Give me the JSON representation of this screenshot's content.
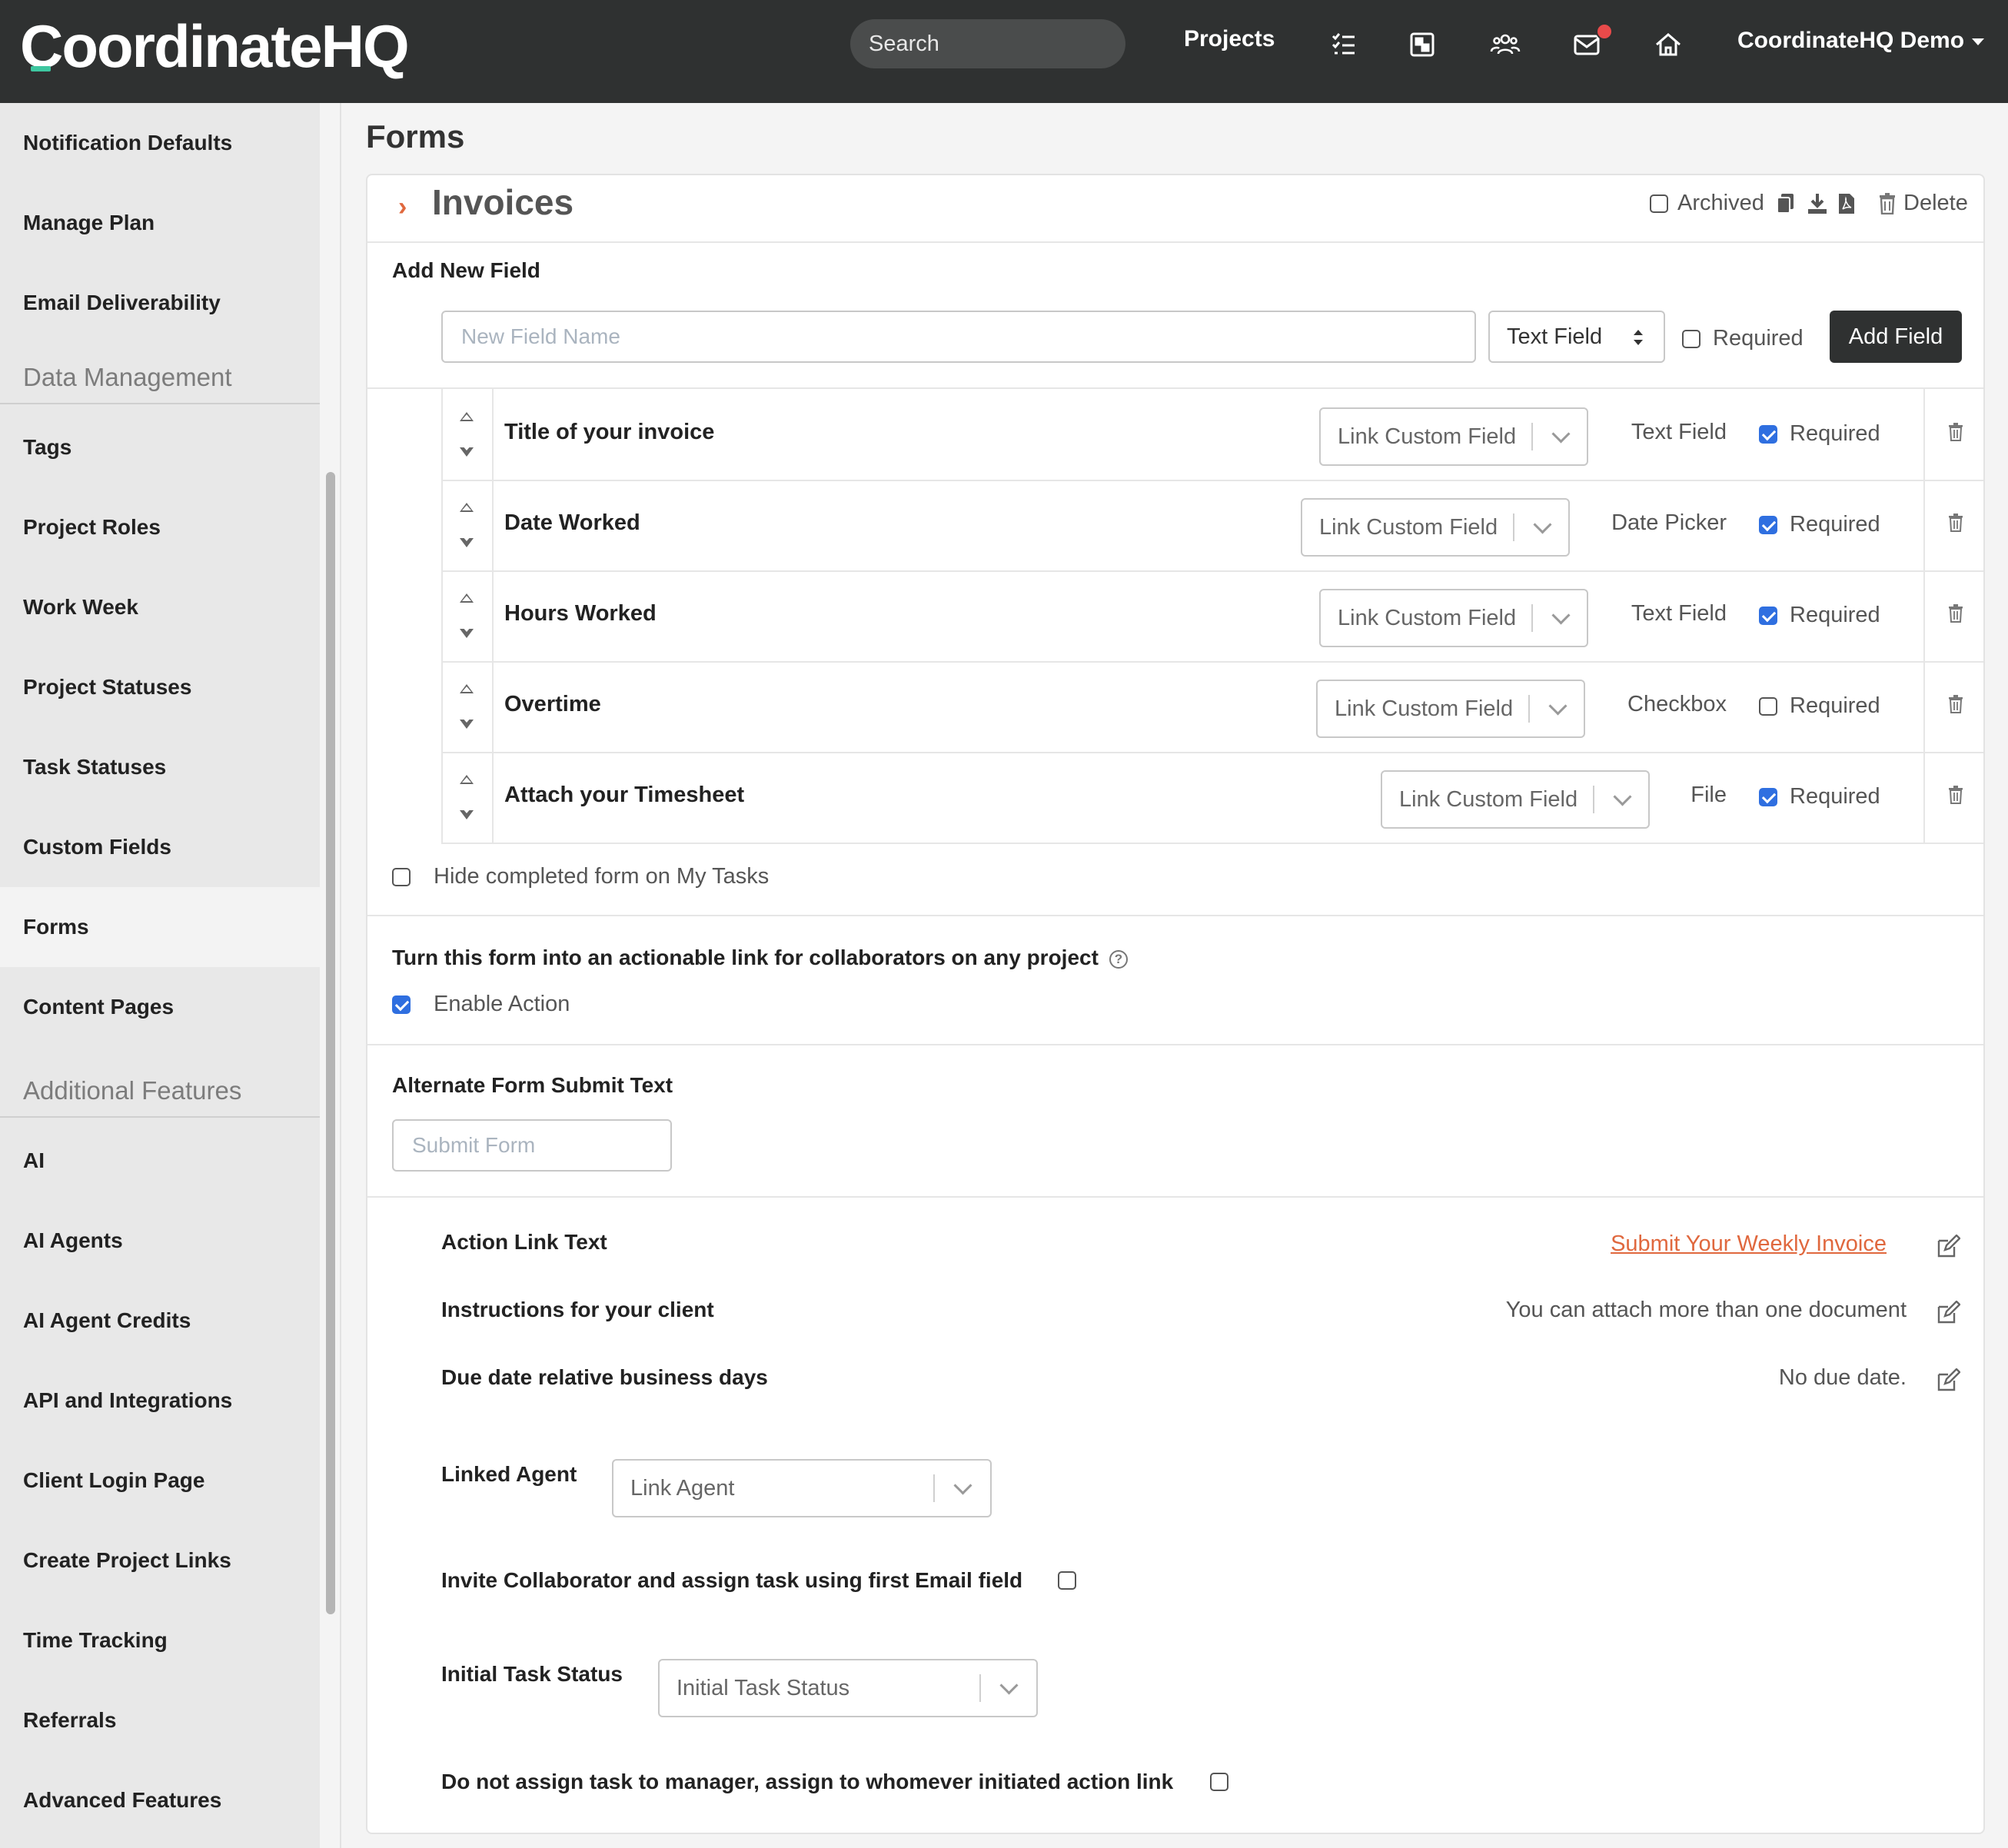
{
  "header": {
    "logo": "CoordinateHQ",
    "search_placeholder": "Search",
    "nav_projects": "Projects",
    "account": "CoordinateHQ Demo"
  },
  "sidebar": {
    "items_top": [
      "Notification Defaults",
      "Manage Plan",
      "Email Deliverability"
    ],
    "section_data": "Data Management",
    "items_data": [
      "Tags",
      "Project Roles",
      "Work Week",
      "Project Statuses",
      "Task Statuses",
      "Custom Fields",
      "Forms",
      "Content Pages"
    ],
    "section_additional": "Additional Features",
    "items_additional": [
      "AI",
      "AI Agents",
      "AI Agent Credits",
      "API and Integrations",
      "Client Login Page",
      "Create Project Links",
      "Time Tracking",
      "Referrals",
      "Advanced Features"
    ],
    "active": "Forms"
  },
  "main": {
    "page_title": "Forms",
    "form_title": "Invoices",
    "archived_label": "Archived",
    "delete_label": "Delete",
    "add_new_field": {
      "heading": "Add New Field",
      "name_placeholder": "New Field Name",
      "type_value": "Text Field",
      "required_label": "Required",
      "add_button": "Add Field"
    },
    "fields": [
      {
        "name": "Title of your invoice",
        "link": "Link Custom Field",
        "type": "Text Field",
        "required": true,
        "required_label": "Required"
      },
      {
        "name": "Date Worked",
        "link": "Link Custom Field",
        "type": "Date Picker",
        "required": true,
        "required_label": "Required"
      },
      {
        "name": "Hours Worked",
        "link": "Link Custom Field",
        "type": "Text Field",
        "required": true,
        "required_label": "Required"
      },
      {
        "name": "Overtime",
        "link": "Link Custom Field",
        "type": "Checkbox",
        "required": false,
        "required_label": "Required"
      },
      {
        "name": "Attach your Timesheet",
        "link": "Link Custom Field",
        "type": "File",
        "required": true,
        "required_label": "Required"
      }
    ],
    "hide_completed_label": "Hide completed form on My Tasks",
    "actionable_heading": "Turn this form into an actionable link for collaborators on any project",
    "enable_action_label": "Enable Action",
    "alt_submit_heading": "Alternate Form Submit Text",
    "alt_submit_placeholder": "Submit Form",
    "action_link_text_label": "Action Link Text",
    "action_link_text_value": "Submit Your Weekly Invoice",
    "instructions_label": "Instructions for your client",
    "instructions_value": "You can attach more than one document",
    "due_date_label": "Due date relative business days",
    "due_date_value": "No due date.",
    "linked_agent_label": "Linked Agent",
    "linked_agent_placeholder": "Link Agent",
    "invite_label": "Invite Collaborator and assign task using first Email field",
    "initial_status_label": "Initial Task Status",
    "initial_status_placeholder": "Initial Task Status",
    "no_assign_label": "Do not assign task to manager, assign to whomever initiated action link"
  },
  "colors": {
    "topbar": "#2f3131",
    "accent": "#e0683e",
    "checkbox": "#2f6fe0",
    "notification": "#e84a4a"
  }
}
